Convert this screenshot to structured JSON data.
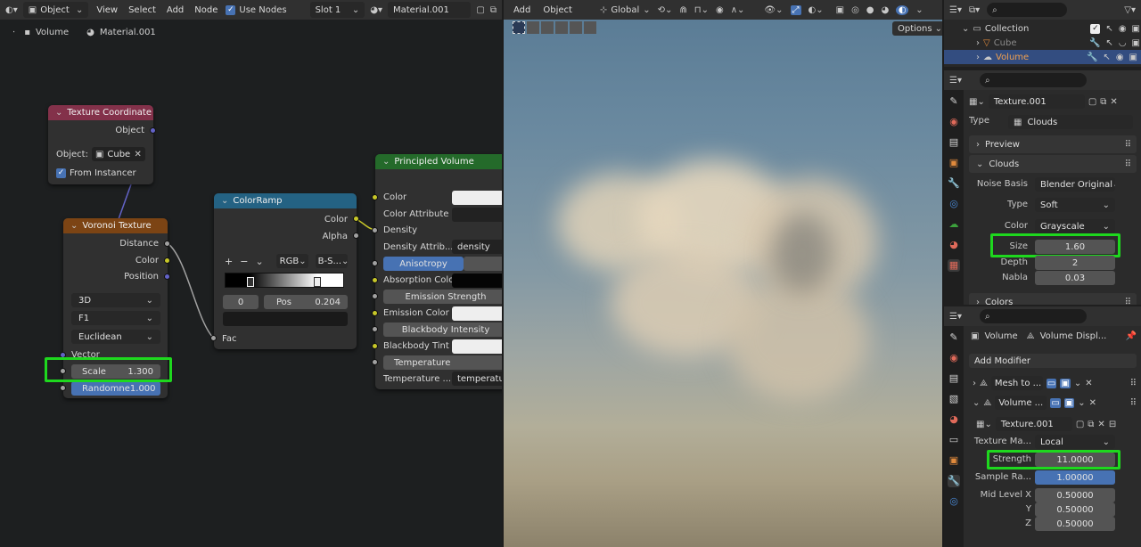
{
  "node_editor": {
    "header": {
      "object_mode": "Object",
      "menus": [
        "View",
        "Select",
        "Add",
        "Node"
      ],
      "use_nodes": "Use Nodes",
      "slot": "Slot 1",
      "material": "Material.001"
    },
    "breadcrumb": {
      "object": "Volume",
      "material": "Material.001"
    },
    "tex_coord": {
      "title": "Texture Coordinate",
      "out_object": "Object",
      "object_label": "Object:",
      "object_value": "Cube",
      "from_instancer": "From Instancer"
    },
    "voronoi": {
      "title": "Voronoi Texture",
      "out_distance": "Distance",
      "out_color": "Color",
      "out_position": "Position",
      "dim": "3D",
      "feature": "F1",
      "metric": "Euclidean",
      "in_vector": "Vector",
      "scale_label": "Scale",
      "scale_value": "1.300",
      "rand_label": "Randomne",
      "rand_value": "1.000"
    },
    "colorramp": {
      "title": "ColorRamp",
      "out_color": "Color",
      "out_alpha": "Alpha",
      "plus": "+",
      "minus": "−",
      "mode": "RGB",
      "interp": "B-S...",
      "index": "0",
      "pos_label": "Pos",
      "pos_value": "0.204",
      "in_fac": "Fac"
    },
    "principled": {
      "title": "Principled Volume",
      "color": "Color",
      "color_attr": "Color Attribute",
      "density": "Density",
      "density_attr": "Density Attrib...",
      "density_attr_value": "density",
      "anisotropy": "Anisotropy",
      "absorption": "Absorption Color",
      "emission_strength": "Emission Strength",
      "emission_color": "Emission Color",
      "blackbody_intensity": "Blackbody Intensity",
      "blackbody_tint": "Blackbody Tint",
      "temperature": "Temperature",
      "temperature_attr": "Temperature ...",
      "temperature_attr_value": "temperature"
    }
  },
  "viewport": {
    "menus": [
      "Add",
      "Object"
    ],
    "orientation": "Global",
    "options": "Options"
  },
  "outliner": {
    "collection": "Collection",
    "cube": "Cube",
    "volume": "Volume"
  },
  "texture_props": {
    "name": "Texture.001",
    "type_label": "Type",
    "type_value": "Clouds",
    "preview": "Preview",
    "clouds": "Clouds",
    "noise_basis_label": "Noise Basis",
    "noise_basis_value": "Blender Original",
    "type2_label": "Type",
    "type2_value": "Soft",
    "color_label": "Color",
    "color_value": "Grayscale",
    "size_label": "Size",
    "size_value": "1.60",
    "depth_label": "Depth",
    "depth_value": "2",
    "nabla_label": "Nabla",
    "nabla_value": "0.03",
    "colors": "Colors"
  },
  "modifier_props": {
    "object": "Volume",
    "modifier_stack": "Volume Displ...",
    "add_modifier": "Add Modifier",
    "mod1": "Mesh to ...",
    "mod2": "Volume ...",
    "texture": "Texture.001",
    "tex_map_label": "Texture Ma...",
    "tex_map_value": "Local",
    "strength_label": "Strength",
    "strength_value": "11.0000",
    "sample_label": "Sample Ra...",
    "sample_value": "1.00000",
    "midx_label": "Mid Level X",
    "midx_value": "0.50000",
    "y_label": "Y",
    "y_value": "0.50000",
    "z_label": "Z",
    "z_value": "0.50000"
  },
  "colors": {
    "highlight": "#1ed81e",
    "accent_blue": "#4772b3"
  }
}
